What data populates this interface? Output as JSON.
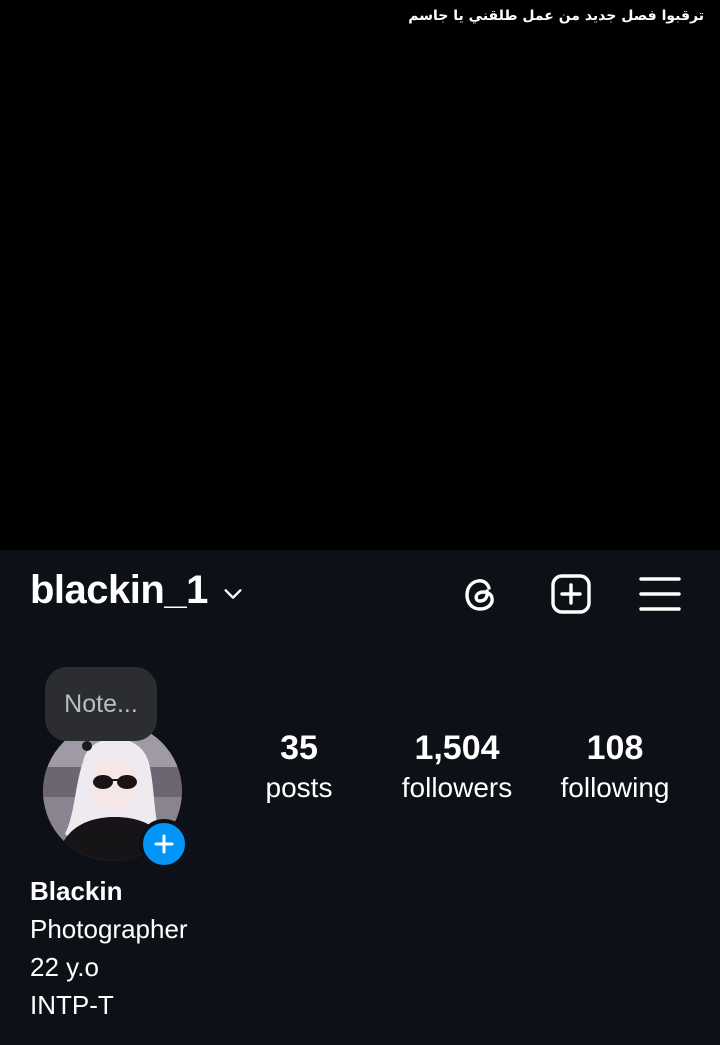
{
  "overlay": {
    "caption": "ترقبوا فصل جديد من عمل طلقني يا جاسم"
  },
  "header": {
    "username": "blackin_1",
    "icons": [
      "chevron-down-icon",
      "threads-icon",
      "create-post-icon",
      "menu-icon"
    ]
  },
  "profile": {
    "note_placeholder": "Note...",
    "stats": {
      "posts": {
        "value": "35",
        "label": "posts"
      },
      "followers": {
        "value": "1,504",
        "label": "followers"
      },
      "following": {
        "value": "108",
        "label": "following"
      }
    },
    "bio": {
      "name": "Blackin",
      "lines": [
        "Photographer",
        "22 y.o",
        "INTP-T"
      ]
    }
  },
  "colors": {
    "background": "#000000",
    "profile_background": "#0d1117",
    "note_bubble": "#2b2d31",
    "accent_blue": "#0095f6"
  }
}
